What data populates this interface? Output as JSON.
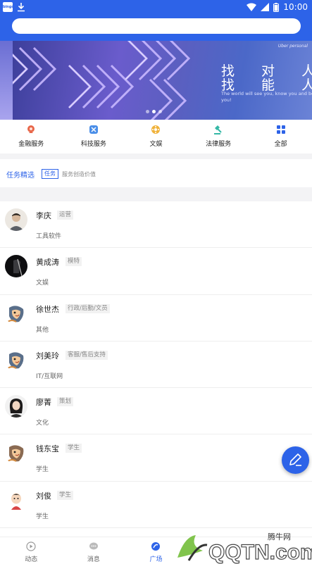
{
  "status_bar": {
    "time": "10:00",
    "app_badge": "bingo"
  },
  "search": {
    "placeholder": ""
  },
  "banner": {
    "headline_line1": "找 对 人",
    "headline_line2": "找 能 人",
    "tagline_top": "Uber personal",
    "tagline": "The world will see you, know you and be with you!",
    "slide_count": 3,
    "active_slide": 1
  },
  "categories": [
    {
      "label": "金融服务",
      "icon": "finance-icon",
      "color": "#e8674a"
    },
    {
      "label": "科技服务",
      "icon": "tech-icon",
      "color": "#4a8ee8"
    },
    {
      "label": "文娱",
      "icon": "entertainment-icon",
      "color": "#f0b23a"
    },
    {
      "label": "法律服务",
      "icon": "law-icon",
      "color": "#35b8a6"
    },
    {
      "label": "全部",
      "icon": "grid-icon",
      "color": "#2d63e8"
    }
  ],
  "task": {
    "title": "任务精选",
    "tag": "任务",
    "subtitle": "服务创造价值"
  },
  "people": [
    {
      "name": "李庆",
      "role": "运营",
      "sector": "工具软件",
      "avatar": "photo-man"
    },
    {
      "name": "黄成涛",
      "role": "模特",
      "sector": "文娱",
      "avatar": "photo-dark"
    },
    {
      "name": "徐世杰",
      "role": "行政/后勤/文员",
      "sector": "其他",
      "avatar": "cartoon"
    },
    {
      "name": "刘美玲",
      "role": "客服/售后支持",
      "sector": "IT/互联网",
      "avatar": "cartoon"
    },
    {
      "name": "廖菁",
      "role": "策划",
      "sector": "文化",
      "avatar": "photo-woman"
    },
    {
      "name": "钱东宝",
      "role": "学生",
      "sector": "学生",
      "avatar": "cartoon"
    },
    {
      "name": "刘俊",
      "role": "学生",
      "sector": "学生",
      "avatar": "cartoon-boy"
    }
  ],
  "bottom_nav": [
    {
      "label": "动态",
      "icon": "play-icon",
      "active": false
    },
    {
      "label": "消息",
      "icon": "chat-icon",
      "active": false
    },
    {
      "label": "广场",
      "icon": "plaza-icon",
      "active": true
    },
    {
      "label": "",
      "icon": "",
      "active": false
    },
    {
      "label": "",
      "icon": "",
      "active": false
    }
  ],
  "watermark": {
    "text": "腾牛网",
    "logo_text": "QQTN.com"
  },
  "colors": {
    "primary": "#2d63e8",
    "divider": "#f3f3f5"
  }
}
